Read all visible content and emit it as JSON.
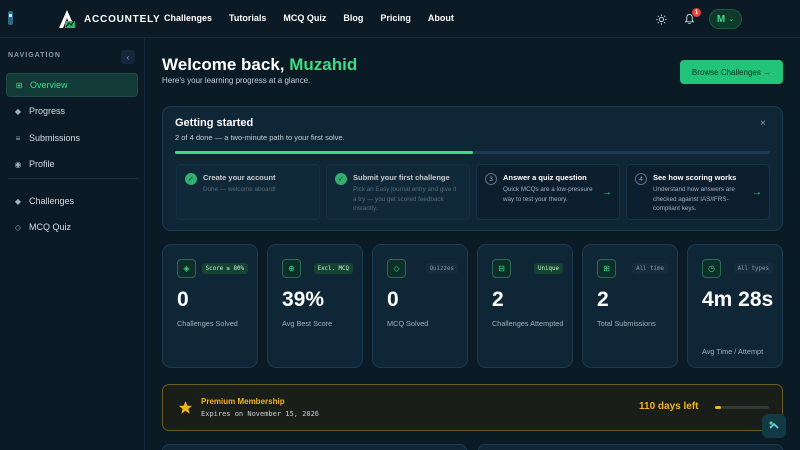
{
  "brand": {
    "name": "ACCOUNTELY"
  },
  "nav": [
    "Challenges",
    "Tutorials",
    "MCQ Quiz",
    "Blog",
    "Pricing",
    "About"
  ],
  "header": {
    "notification_count": "1",
    "avatar_initial": "M",
    "avatar_caret": "⌄"
  },
  "sidebar": {
    "heading": "NAVIGATION",
    "collapse": "‹",
    "items": [
      {
        "label": "Overview",
        "icon": "grid-icon",
        "glyph": "⊞"
      },
      {
        "label": "Progress",
        "icon": "diamond-icon",
        "glyph": "◆"
      },
      {
        "label": "Submissions",
        "icon": "list-icon",
        "glyph": "≡"
      },
      {
        "label": "Profile",
        "icon": "user-circle-icon",
        "glyph": "◉"
      },
      {
        "label": "Challenges",
        "icon": "diamond-icon",
        "glyph": "◆"
      },
      {
        "label": "MCQ Quiz",
        "icon": "diamond-outline-icon",
        "glyph": "◇"
      }
    ]
  },
  "welcome": {
    "greeting": "Welcome back,",
    "name": "Muzahid",
    "subtitle": "Here's your learning progress at a glance.",
    "browse_label": "Browse Challenges →"
  },
  "getting_started": {
    "title": "Getting started",
    "subtitle": "2 of 4 done — a two-minute path to your first solve.",
    "close": "×",
    "progress": 0.5,
    "steps": [
      {
        "status": "done",
        "mark": "✓",
        "title": "Create your account",
        "desc": "Done — welcome aboard!"
      },
      {
        "status": "done",
        "mark": "✓",
        "title": "Submit your first challenge",
        "desc": "Pick an Easy journal entry and give it a try — you get scored feedback instantly."
      },
      {
        "status": "todo",
        "mark": "3",
        "title": "Answer a quiz question",
        "desc": "Quick MCQs are a low-pressure way to test your theory.",
        "arrow": "→"
      },
      {
        "status": "todo",
        "mark": "4",
        "title": "See how scoring works",
        "desc": "Understand how answers are checked against IAS/IFRS-compliant keys.",
        "arrow": "→"
      }
    ]
  },
  "stats": [
    {
      "icon": "target-icon",
      "glyph": "◈",
      "tag": "Score ≥ 80%",
      "tag_style": "green",
      "value": "0",
      "label": "Challenges Solved"
    },
    {
      "icon": "crosshair-icon",
      "glyph": "⊕",
      "tag": "Excl. MCQ",
      "tag_style": "green",
      "value": "39%",
      "label": "Avg Best Score"
    },
    {
      "icon": "diamond-outline-icon",
      "glyph": "◇",
      "tag": "Quizzes",
      "tag_style": "gray",
      "value": "0",
      "label": "MCQ Solved"
    },
    {
      "icon": "document-icon",
      "glyph": "⊟",
      "tag": "Unique",
      "tag_style": "green",
      "value": "2",
      "label": "Challenges Attempted"
    },
    {
      "icon": "grid-icon",
      "glyph": "⊞",
      "tag": "All time",
      "tag_style": "gray",
      "value": "2",
      "label": "Total Submissions"
    },
    {
      "icon": "timer-icon",
      "glyph": "◷",
      "tag": "All types",
      "tag_style": "gray",
      "value": "4m 28s",
      "label": "Avg Time / Attempt"
    }
  ],
  "premium": {
    "title": "Premium Membership",
    "expires": "Expires on November 15, 2026",
    "days_left": "110 days left",
    "remaining_fraction": 0.12
  },
  "colors": {
    "accent": "#3ddc84",
    "gold": "#f2b41c",
    "background": "#0a1b25",
    "card": "#0f2637"
  }
}
